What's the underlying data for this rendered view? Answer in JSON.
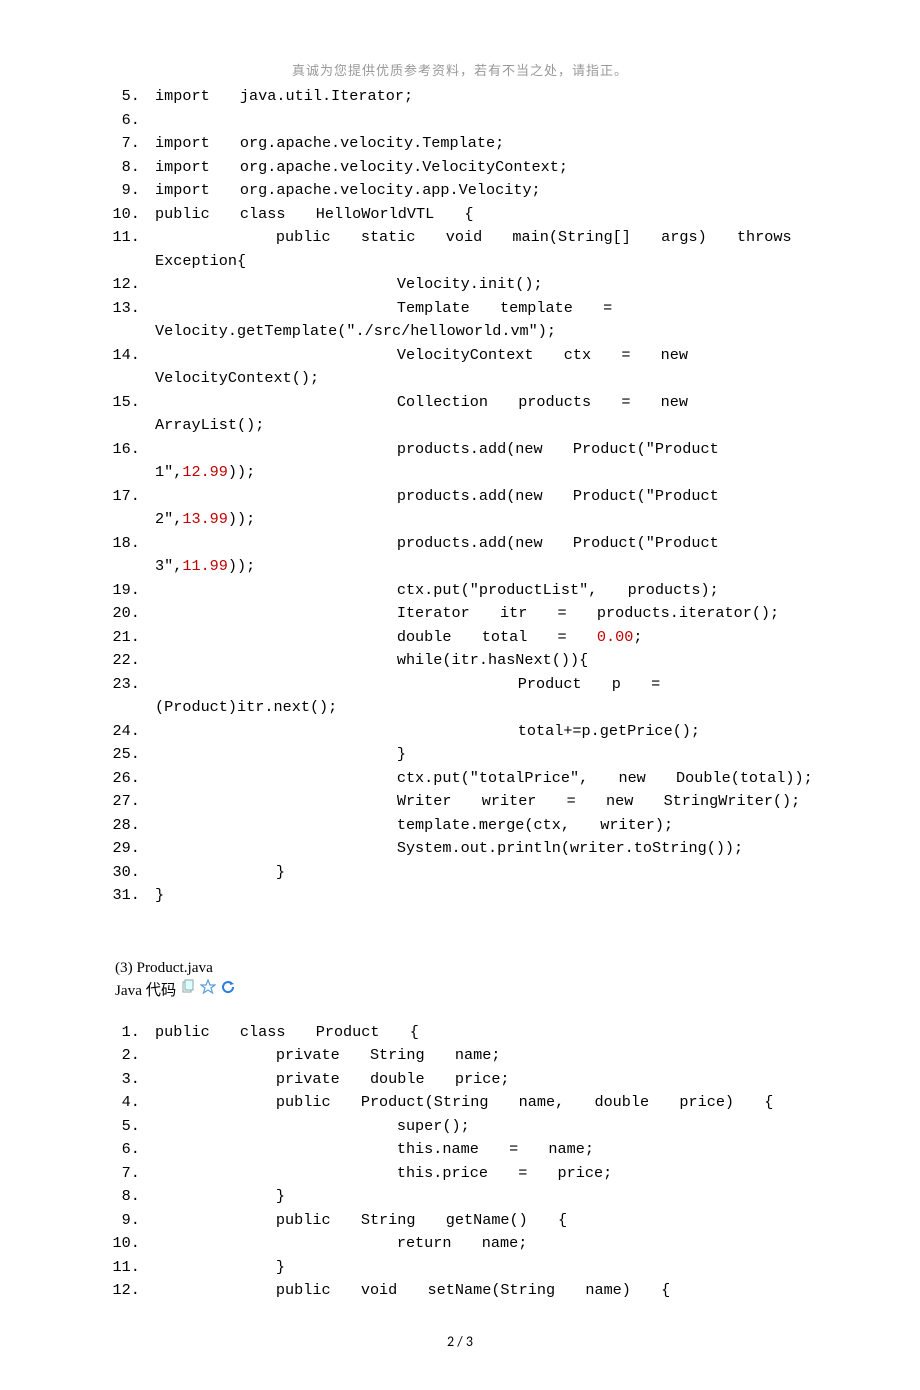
{
  "header_note": "真诚为您提供优质参考资料，若有不当之处，请指正。",
  "block1": {
    "start": 5,
    "lines": [
      [
        {
          "t": "import  java.util.Iterator;  "
        }
      ],
      [
        {
          "t": "  "
        }
      ],
      [
        {
          "t": "import  org.apache.velocity.Template;  "
        }
      ],
      [
        {
          "t": "import  org.apache.velocity.VelocityContext;  "
        }
      ],
      [
        {
          "t": "import  org.apache.velocity.app.Velocity;  "
        }
      ],
      [
        {
          "t": "public  class  HelloWorldVTL  {  "
        }
      ],
      [
        {
          "t": "        public  static  void  main(String[]  args)  throws  Exception{  "
        }
      ],
      [
        {
          "t": "                Velocity.init();  "
        }
      ],
      [
        {
          "t": "                Template  template  =  Velocity.getTemplate(\"./src/helloworld.vm\");  "
        }
      ],
      [
        {
          "t": "                VelocityContext  ctx  =  new  VelocityContext();  "
        }
      ],
      [
        {
          "t": "                Collection  products  =  new  ArrayList();  "
        }
      ],
      [
        {
          "t": "                products.add(new  Product(\"Product  1\","
        },
        {
          "t": "12.99",
          "n": true
        },
        {
          "t": "));  "
        }
      ],
      [
        {
          "t": "                products.add(new  Product(\"Product  2\","
        },
        {
          "t": "13.99",
          "n": true
        },
        {
          "t": "));  "
        }
      ],
      [
        {
          "t": "                products.add(new  Product(\"Product  3\","
        },
        {
          "t": "11.99",
          "n": true
        },
        {
          "t": "));  "
        }
      ],
      [
        {
          "t": "                ctx.put(\"productList\",  products);  "
        }
      ],
      [
        {
          "t": "                Iterator  itr  =  products.iterator();  "
        }
      ],
      [
        {
          "t": "                double  total  =  "
        },
        {
          "t": "0.00",
          "n": true
        },
        {
          "t": ";  "
        }
      ],
      [
        {
          "t": "                while(itr.hasNext()){  "
        }
      ],
      [
        {
          "t": "                        Product  p  =  (Product)itr.next();  "
        }
      ],
      [
        {
          "t": "                        total+=p.getPrice();  "
        }
      ],
      [
        {
          "t": "                }  "
        }
      ],
      [
        {
          "t": "                ctx.put(\"totalPrice\",  new  Double(total));  "
        }
      ],
      [
        {
          "t": "                Writer  writer  =  new  StringWriter();  "
        }
      ],
      [
        {
          "t": "                template.merge(ctx,  writer);  "
        }
      ],
      [
        {
          "t": "                System.out.println(writer.toString());  "
        }
      ],
      [
        {
          "t": "        }  "
        }
      ],
      [
        {
          "t": "}  "
        }
      ]
    ]
  },
  "section_label": "(3) Product.java",
  "java_label": "Java 代码",
  "block2": {
    "start": 1,
    "lines": [
      [
        {
          "t": "public  class  Product  {  "
        }
      ],
      [
        {
          "t": "        private  String  name;  "
        }
      ],
      [
        {
          "t": "        private  double  price;  "
        }
      ],
      [
        {
          "t": "        public  Product(String  name,  double  price)  {  "
        }
      ],
      [
        {
          "t": "                super();  "
        }
      ],
      [
        {
          "t": "                this.name  =  name;  "
        }
      ],
      [
        {
          "t": "                this.price  =  price;  "
        }
      ],
      [
        {
          "t": "        }  "
        }
      ],
      [
        {
          "t": "        public  String  getName()  {  "
        }
      ],
      [
        {
          "t": "                return  name;  "
        }
      ],
      [
        {
          "t": "        }  "
        }
      ],
      [
        {
          "t": "        public  void  setName(String  name)  {  "
        }
      ]
    ]
  },
  "footer": "2 / 3"
}
